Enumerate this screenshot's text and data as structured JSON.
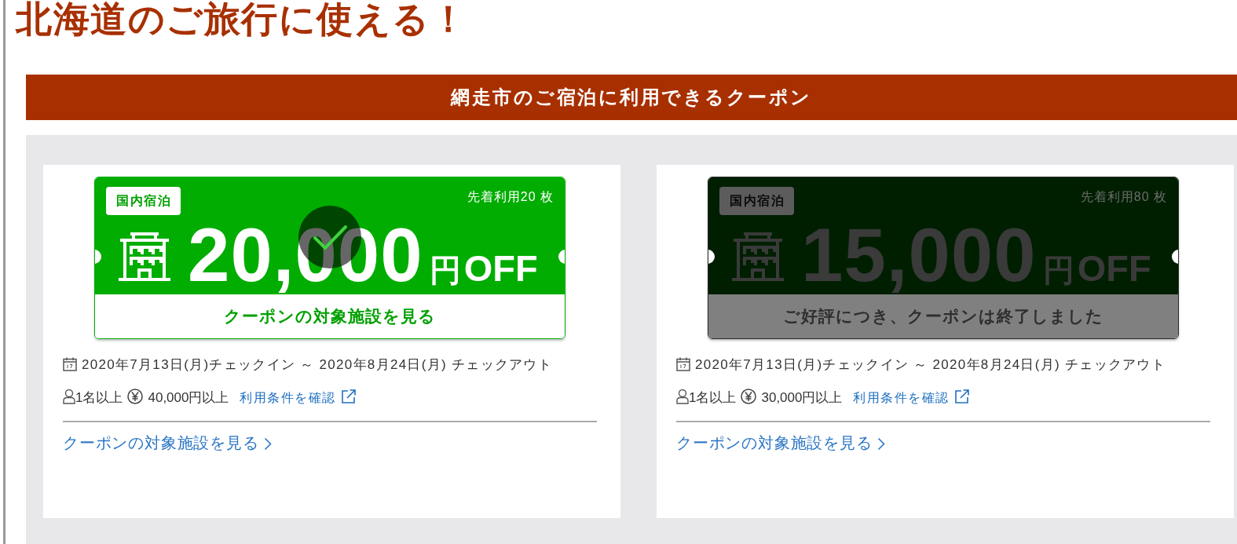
{
  "headline": "北海道のご旅行に使える！",
  "section": {
    "title": "網走市のご宿泊に利用できるクーポン"
  },
  "coupons": [
    {
      "ended": false,
      "acquired": true,
      "category": "国内宿泊",
      "quantity": "先着利用20 枚",
      "amount": "20,000",
      "currency": "円",
      "suffix": "OFF",
      "footer": "クーポンの対象施設を見る",
      "period": "2020年7月13日(月)チェックイン ～ 2020年8月24日(月) チェックアウト",
      "guests": "1名以上",
      "minimum": "40,000円以上",
      "terms_link": "利用条件を確認",
      "facilities_link": "クーポンの対象施設を見る"
    },
    {
      "ended": true,
      "acquired": false,
      "category": "国内宿泊",
      "quantity": "先着利用80 枚",
      "amount": "15,000",
      "currency": "円",
      "suffix": "OFF",
      "footer": "ご好評につき、クーポンは終了しました",
      "period": "2020年7月13日(月)チェックイン ～ 2020年8月24日(月) チェックアウト",
      "guests": "1名以上",
      "minimum": "30,000円以上",
      "terms_link": "利用条件を確認",
      "facilities_link": "クーポンの対象施設を見る"
    }
  ]
}
